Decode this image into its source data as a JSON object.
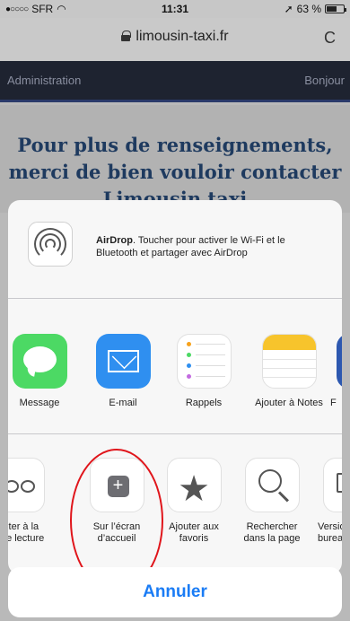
{
  "status_bar": {
    "carrier": "SFR",
    "time": "11:31",
    "battery_percent": "63 %",
    "battery_level": 0.63
  },
  "browser": {
    "url": "limousin-taxi.fr"
  },
  "page": {
    "admin_left": "Administration",
    "admin_right": "Bonjour",
    "heading_line1": "Pour plus de renseignements,",
    "heading_line2": "merci de bien vouloir contacter",
    "heading_line3": "Limousin taxi"
  },
  "share_sheet": {
    "airdrop": {
      "title": "AirDrop",
      "description": ". Toucher pour activer le Wi-Fi et le Bluetooth et partager avec AirDrop"
    },
    "apps": [
      {
        "label": "Message",
        "icon": "messages-icon"
      },
      {
        "label": "E-mail",
        "icon": "mail-icon"
      },
      {
        "label": "Rappels",
        "icon": "reminders-icon"
      },
      {
        "label": "Ajouter à Notes",
        "icon": "notes-icon"
      },
      {
        "label": "F",
        "icon": "app-icon"
      }
    ],
    "actions": [
      {
        "label": "Ajouter à la liste de lecture",
        "label_visible": "jouter à la\nte de lecture",
        "icon": "reading-list-icon"
      },
      {
        "label": "Sur l’écran d’accueil",
        "icon": "add-to-home-icon"
      },
      {
        "label": "Ajouter aux favoris",
        "icon": "star-icon"
      },
      {
        "label": "Rechercher dans la page",
        "icon": "search-icon"
      },
      {
        "label": "Versio bureau",
        "label_visible": "Versio\nbureau",
        "icon": "desktop-icon"
      }
    ],
    "cancel_label": "Annuler"
  },
  "colors": {
    "accent": "#1a7cf5",
    "annotation": "#e0151b"
  }
}
